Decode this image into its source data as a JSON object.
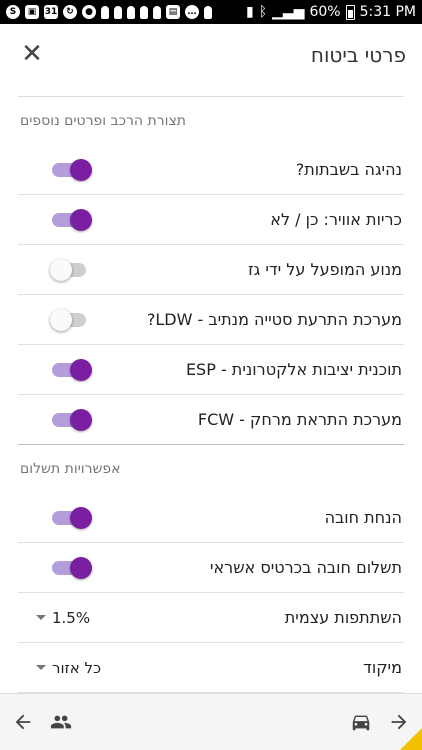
{
  "status_bar": {
    "battery_text": "60%",
    "time": "5:31 PM",
    "notification_icons": [
      "skype-icon",
      "photo-icon",
      "calendar-icon",
      "sync-icon",
      "location-icon",
      "pawn-icon",
      "pawn-icon",
      "pawn-icon",
      "pawn-icon",
      "pawn-icon",
      "map-icon",
      "chat-icon",
      "pawn-icon"
    ]
  },
  "app_bar": {
    "title": "פרטי ביטוח",
    "close_icon": "close-icon"
  },
  "sections": [
    {
      "header": "תצורת הרכב ופרטים נוספים",
      "items": [
        {
          "label": "נהיגה בשבתות?",
          "type": "toggle",
          "on": true
        },
        {
          "label": "כריות אוויר: כן / לא",
          "type": "toggle",
          "on": true
        },
        {
          "label": "מנוע המופעל על ידי גז",
          "type": "toggle",
          "on": false
        },
        {
          "label": "מערכת התרעת סטייה מנתיב - LDW?",
          "type": "toggle",
          "on": false
        },
        {
          "label": "תוכנית יציבות אלקטרונית - ESP",
          "type": "toggle",
          "on": true
        },
        {
          "label": "מערכת התראת מרחק - FCW",
          "type": "toggle",
          "on": true
        }
      ]
    },
    {
      "header": "אפשרויות תשלום",
      "items": [
        {
          "label": "הנחת חובה",
          "type": "toggle",
          "on": true
        },
        {
          "label": "תשלום חובה בכרטיס אשראי",
          "type": "toggle",
          "on": true
        },
        {
          "label": "השתתפות עצמית",
          "type": "select",
          "value": "1.5%"
        },
        {
          "label": "מיקוד",
          "type": "select",
          "value": "כל אזור"
        }
      ]
    }
  ],
  "bottom_bar": {
    "left_icons": [
      "back-arrow-icon",
      "people-icon"
    ],
    "right_icons": [
      "car-icon",
      "forward-arrow-icon"
    ]
  },
  "colors": {
    "accent": "#7b1fa2",
    "accent_track": "#b39ddb",
    "off_track": "#cfcfcf"
  }
}
